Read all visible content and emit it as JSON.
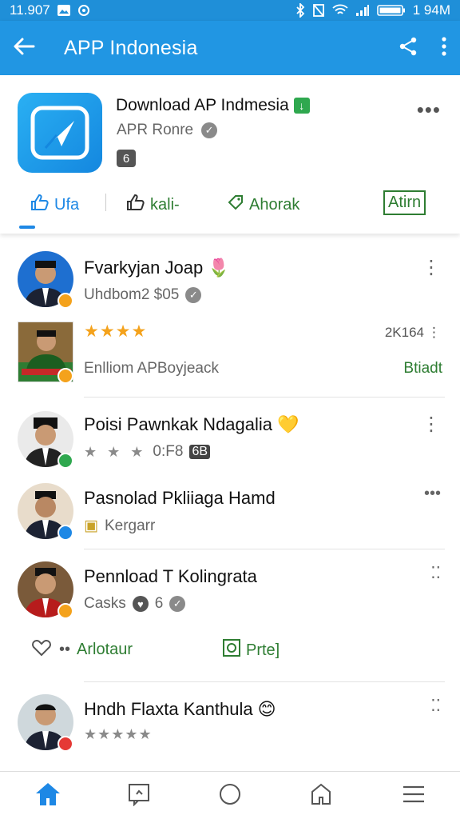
{
  "status_bar": {
    "time": "11.907",
    "right_text": "1 94M"
  },
  "app_bar": {
    "title": "APP Indonesia"
  },
  "header": {
    "app_name": "Download AP Indmesia",
    "developer": "APR Ronre",
    "count": "6",
    "actions": [
      {
        "label": "Ufa",
        "icon": "thumbs-up-icon"
      },
      {
        "label": "kali-",
        "icon": "hand-thumb-icon"
      },
      {
        "label": "Ahorak",
        "icon": "tag-icon"
      },
      {
        "label": "Atirn"
      }
    ]
  },
  "feed": [
    {
      "name": "Fvarkyjan Joap",
      "sub": "Uhdbom2 $05",
      "badge_color": "#f4a21c"
    },
    {
      "rating_stars": "★★★★",
      "count": "2K164",
      "sub": "Enlliom APBoyjeack",
      "action": "Btiadt"
    },
    {
      "name": "Poisi Pawnkak Ndagalia",
      "rating": "0:F8",
      "tag": "6B",
      "badge_color": "#2fa84f"
    },
    {
      "name": "Pasnolad Pkliiaga Hamd",
      "sub": "Kergarr",
      "badge_color": "#1e88e5"
    },
    {
      "name": "Pennload T Kolingrata",
      "sub": "Casks",
      "count": "6",
      "badge_color": "#f4a21c",
      "actions": [
        {
          "label": "Arlotaur"
        },
        {
          "label": "Prte]"
        }
      ]
    },
    {
      "name": "Hndh Flaxta Kanthula",
      "badge_color": "#e53935"
    }
  ],
  "bottom_nav": [
    "home-icon",
    "message-icon",
    "circle-icon",
    "house-icon",
    "menu-icon"
  ]
}
